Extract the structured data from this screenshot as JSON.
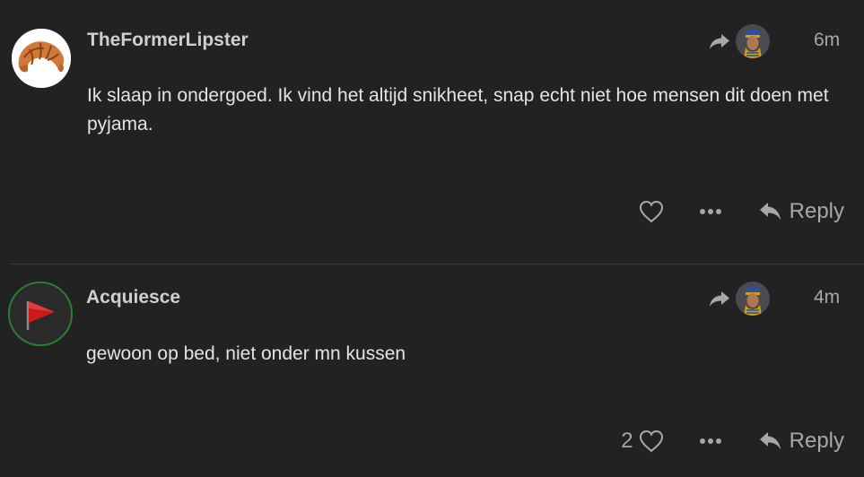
{
  "colors": {
    "background": "#222222",
    "text": "#e4e4e4",
    "muted": "#a8a8a8",
    "divider": "#3a3a3a",
    "flag_red": "#cc1a1a",
    "avatar_ring": "#2e7d32"
  },
  "posts": [
    {
      "username": "TheFormerLipster",
      "avatar_icon": "croissant-icon",
      "time": "6m",
      "body": "Ik slaap in ondergoed. Ik vind het altijd snikheet, snap echt niet hoe mensen dit doen met pyjama.",
      "like_count": "",
      "reply_label": "Reply"
    },
    {
      "username": "Acquiesce",
      "avatar_icon": "red-flag-icon",
      "time": "4m",
      "body": "gewoon op bed, niet onder mn kussen",
      "like_count": "2",
      "reply_label": "Reply"
    }
  ]
}
